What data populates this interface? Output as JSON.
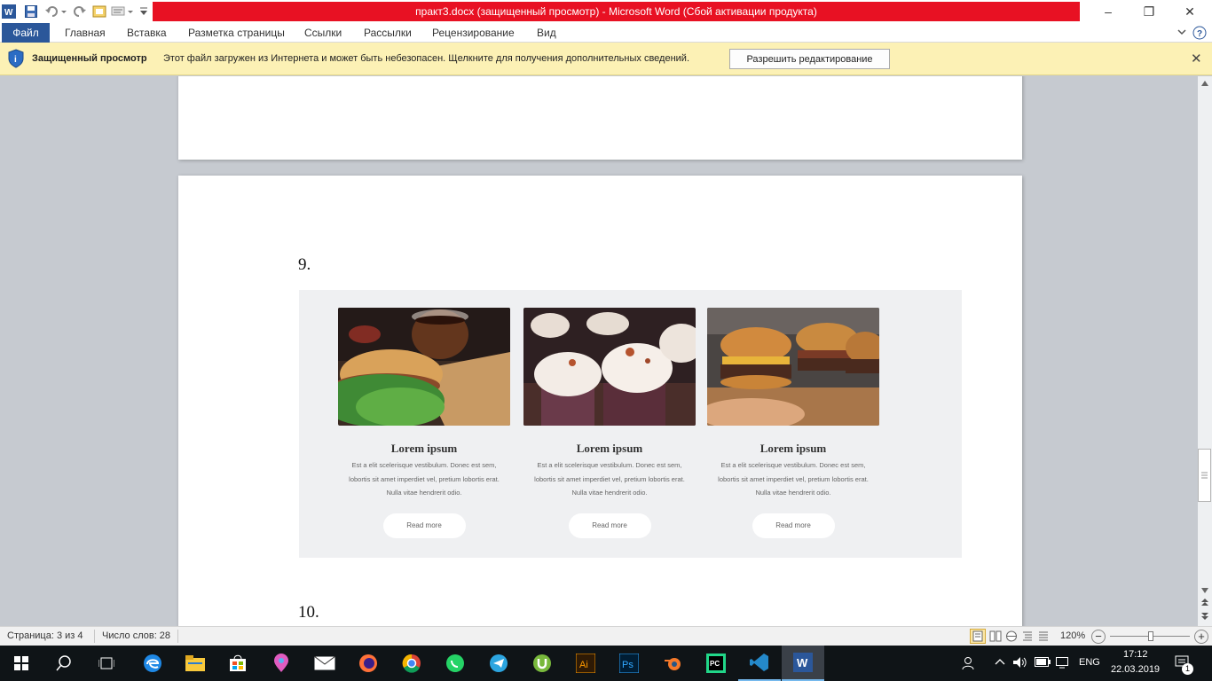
{
  "window": {
    "title": "практ3.docx (защищенный просмотр)  -  Microsoft Word (Сбой активации продукта)",
    "minimize": "–",
    "restore": "❐",
    "close": "✕"
  },
  "ribbon": {
    "tabs": [
      "Файл",
      "Главная",
      "Вставка",
      "Разметка страницы",
      "Ссылки",
      "Рассылки",
      "Рецензирование",
      "Вид"
    ]
  },
  "protected_view": {
    "title": "Защищенный просмотр",
    "message": "Этот файл загружен из Интернета и может быть небезопасен. Щелкните для получения дополнительных сведений.",
    "button": "Разрешить редактирование",
    "close": "✕"
  },
  "document": {
    "heading_9": "9.",
    "heading_10": "10.",
    "cards": [
      {
        "title": "Lorem ipsum",
        "text": "Est a elit scelerisque vestibulum. Donec est sem, lobortis sit amet imperdiet vel, pretium lobortis erat. Nulla vitae hendrerit odio.",
        "button": "Read more",
        "image": "sandwich-coffee"
      },
      {
        "title": "Lorem ipsum",
        "text": "Est a elit scelerisque vestibulum. Donec est sem, lobortis sit amet imperdiet vel, pretium lobortis erat. Nulla vitae hendrerit odio.",
        "button": "Read more",
        "image": "cupcakes"
      },
      {
        "title": "Lorem ipsum",
        "text": "Est a elit scelerisque vestibulum. Donec est sem, lobortis sit amet imperdiet vel, pretium lobortis erat. Nulla vitae hendrerit odio.",
        "button": "Read more",
        "image": "burgers"
      }
    ]
  },
  "status": {
    "page": "Страница: 3 из 4",
    "words": "Число слов: 28",
    "zoom": "120%",
    "zoom_minus": "−",
    "zoom_plus": "+"
  },
  "taskbar": {
    "lang": "ENG",
    "time": "17:12",
    "date": "22.03.2019",
    "notifications": "1"
  },
  "colors": {
    "title_red": "#e81123",
    "file_tab": "#2b579a",
    "protected_bar": "#fcf1b5",
    "taskbar": "#0f1417"
  }
}
